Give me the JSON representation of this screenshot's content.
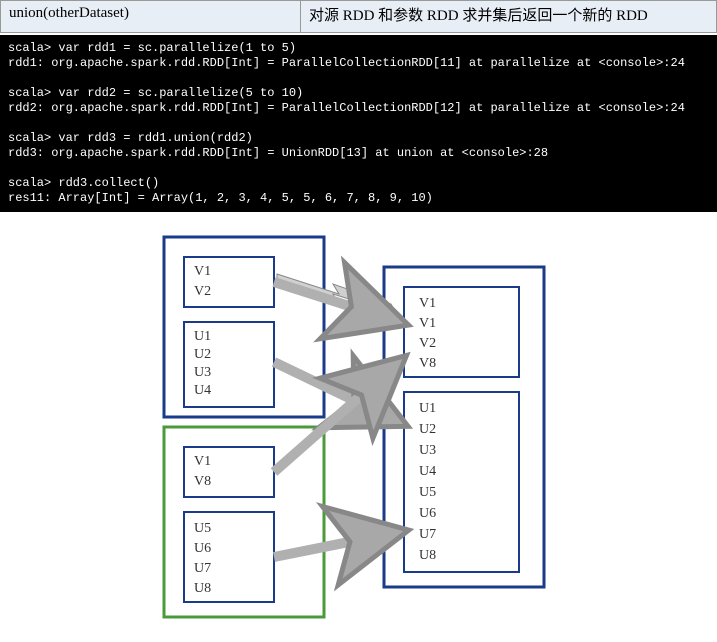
{
  "header": {
    "method_name": "union(otherDataset)",
    "description": "对源 RDD 和参数 RDD 求并集后返回一个新的 RDD"
  },
  "terminal": {
    "line1": "scala> var rdd1 = sc.parallelize(1 to 5)",
    "line2": "rdd1: org.apache.spark.rdd.RDD[Int] = ParallelCollectionRDD[11] at parallelize at <console>:24",
    "line3": "",
    "line4": "scala> var rdd2 = sc.parallelize(5 to 10)",
    "line5": "rdd2: org.apache.spark.rdd.RDD[Int] = ParallelCollectionRDD[12] at parallelize at <console>:24",
    "line6": "",
    "line7": "scala> var rdd3 = rdd1.union(rdd2)",
    "line8": "rdd3: org.apache.spark.rdd.RDD[Int] = UnionRDD[13] at union at <console>:28",
    "line9": "",
    "line10": "scala> rdd3.collect()",
    "line11": "res11: Array[Int] = Array(1, 2, 3, 4, 5, 5, 6, 7, 8, 9, 10)"
  },
  "diagram": {
    "box1": {
      "items": [
        "V1",
        "V2"
      ]
    },
    "box2": {
      "items": [
        "U1",
        "U2",
        "U3",
        "U4"
      ]
    },
    "box3": {
      "items": [
        "V1",
        "V8"
      ]
    },
    "box4": {
      "items": [
        "U5",
        "U6",
        "U7",
        "U8"
      ]
    },
    "result1": {
      "items": [
        "V1",
        "V1",
        "V2",
        "V8"
      ]
    },
    "result2": {
      "items": [
        "U1",
        "U2",
        "U3",
        "U4",
        "U5",
        "U6",
        "U7",
        "U8"
      ]
    }
  }
}
